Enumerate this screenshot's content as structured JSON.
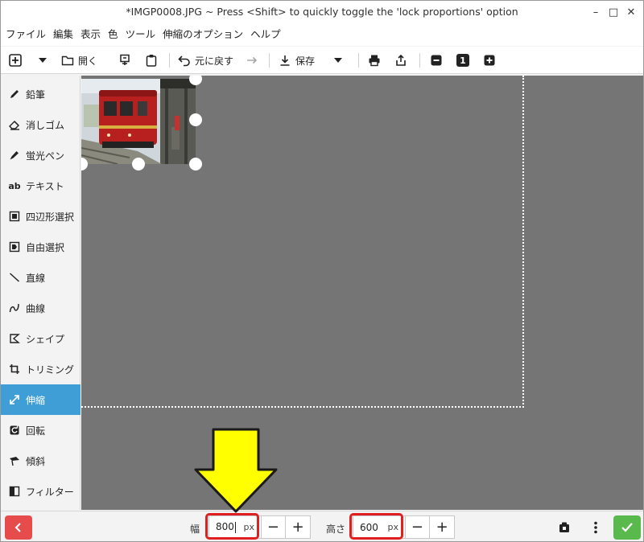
{
  "window": {
    "title": "*IMGP0008.JPG ~ Press <Shift> to quickly toggle the 'lock proportions' option",
    "minimize_glyph": "–",
    "maximize_glyph": "□",
    "close_glyph": "✕"
  },
  "menu": [
    {
      "label": "ファイル"
    },
    {
      "label": "編集"
    },
    {
      "label": "表示"
    },
    {
      "label": "色"
    },
    {
      "label": "ツール"
    },
    {
      "label": "伸縮のオプション"
    },
    {
      "label": "ヘルプ"
    }
  ],
  "toolbar": {
    "new_icon": "plus-square-icon",
    "open_label": "開く",
    "undo_label": "元に戻す",
    "save_label": "保存",
    "zoom_level": "1"
  },
  "sidebar": {
    "tools": [
      {
        "label": "鉛筆",
        "icon": "pencil-icon",
        "active": false
      },
      {
        "label": "消しゴム",
        "icon": "eraser-icon",
        "active": false
      },
      {
        "label": "蛍光ペン",
        "icon": "highlighter-icon",
        "active": false
      },
      {
        "label": "テキスト",
        "icon": "text-icon",
        "glyph": "ab",
        "active": false
      },
      {
        "label": "四辺形選択",
        "icon": "rect-select-icon",
        "active": false
      },
      {
        "label": "自由選択",
        "icon": "free-select-icon",
        "active": false
      },
      {
        "label": "直線",
        "icon": "line-icon",
        "active": false
      },
      {
        "label": "曲線",
        "icon": "curve-icon",
        "active": false
      },
      {
        "label": "シェイプ",
        "icon": "shape-icon",
        "active": false
      },
      {
        "label": "トリミング",
        "icon": "crop-icon",
        "active": false
      },
      {
        "label": "伸縮",
        "icon": "scale-icon",
        "active": true
      },
      {
        "label": "回転",
        "icon": "rotate-icon",
        "active": false
      },
      {
        "label": "傾斜",
        "icon": "skew-icon",
        "active": false
      },
      {
        "label": "フィルター",
        "icon": "filter-icon",
        "active": false
      }
    ]
  },
  "bottombar": {
    "width_label": "幅",
    "width_value": "800",
    "width_unit": "px",
    "height_label": "高さ",
    "height_value": "600",
    "height_unit": "px",
    "minus_glyph": "−",
    "plus_glyph": "+"
  },
  "colors": {
    "accent": "#3f9ed6",
    "back_button": "#e74c4c",
    "ok_button": "#5ab94c",
    "canvas": "#757575",
    "highlight_box": "#e02020",
    "arrow_fill": "#ffff00"
  }
}
